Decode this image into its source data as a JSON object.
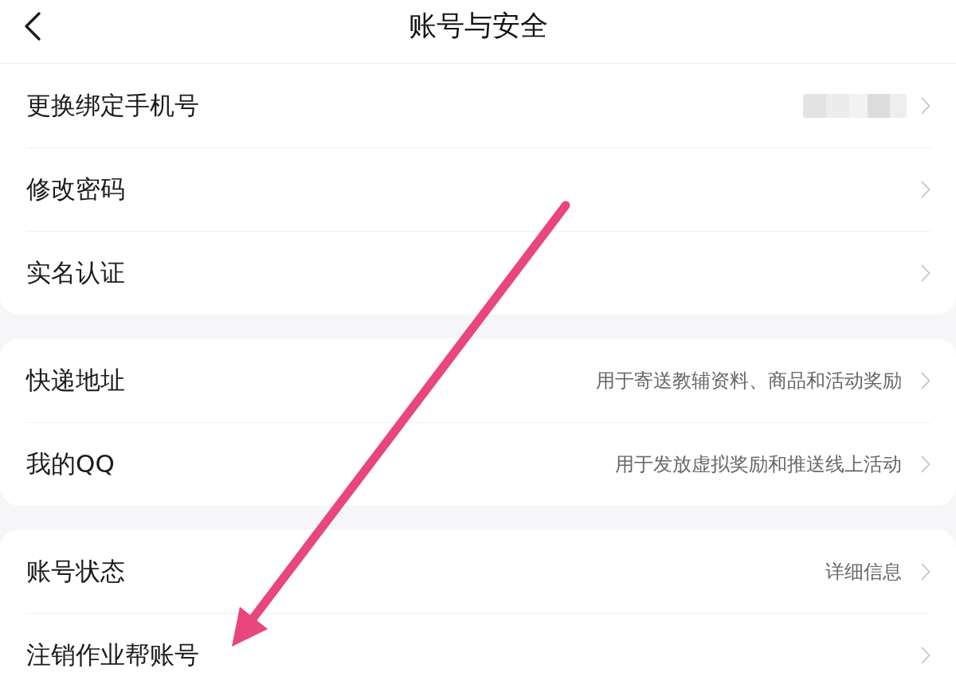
{
  "header": {
    "title": "账号与安全"
  },
  "groups": [
    {
      "rows": [
        {
          "label": "更换绑定手机号",
          "value_blurred": true
        },
        {
          "label": "修改密码",
          "value_blurred": false
        },
        {
          "label": "实名认证",
          "value_blurred": false
        }
      ]
    },
    {
      "rows": [
        {
          "label": "快递地址",
          "value": "用于寄送教辅资料、商品和活动奖励",
          "value_blurred": false
        },
        {
          "label": "我的QQ",
          "value": "用于发放虚拟奖励和推送线上活动",
          "value_blurred": false
        }
      ]
    },
    {
      "rows": [
        {
          "label": "账号状态",
          "value": "详细信息",
          "value_blurred": false
        },
        {
          "label": "注销作业帮账号",
          "value_blurred": false
        }
      ]
    }
  ],
  "annotations": [
    {
      "kind": "arrow"
    }
  ]
}
